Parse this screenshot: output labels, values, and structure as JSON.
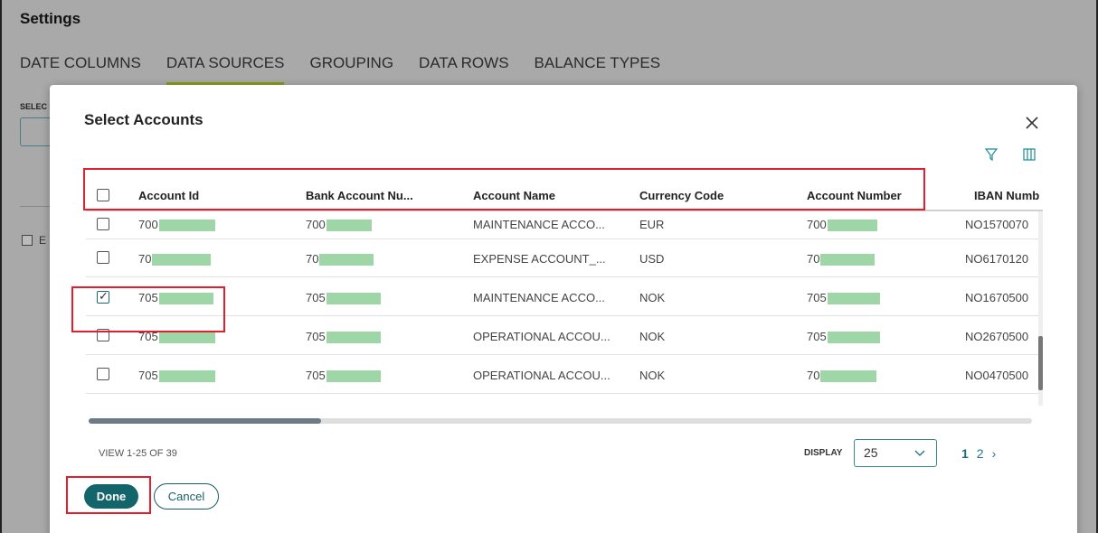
{
  "settings": {
    "title": "Settings",
    "tabs": [
      "DATE COLUMNS",
      "DATA SOURCES",
      "GROUPING",
      "DATA ROWS",
      "BALANCE TYPES"
    ],
    "active_tab": "DATA SOURCES",
    "bg_label": "SELEC",
    "bg_check_label": "E"
  },
  "modal": {
    "title": "Select Accounts",
    "columns": [
      "Account Id",
      "Bank Account Nu...",
      "Account Name",
      "Currency Code",
      "Account Number",
      "IBAN Numb"
    ],
    "rows": [
      {
        "checked": false,
        "account_id": "700",
        "bank_account": "700",
        "account_name": "MAINTENANCE ACCO...",
        "currency": "EUR",
        "account_number": "700",
        "iban": "NO1570070"
      },
      {
        "checked": false,
        "account_id": "70",
        "bank_account": "70",
        "account_name": "EXPENSE ACCOUNT_...",
        "currency": "USD",
        "account_number": "70",
        "iban": "NO6170120"
      },
      {
        "checked": true,
        "account_id": "705",
        "bank_account": "705",
        "account_name": "MAINTENANCE ACCO...",
        "currency": "NOK",
        "account_number": "705",
        "iban": "NO1670500"
      },
      {
        "checked": false,
        "account_id": "705",
        "bank_account": "705",
        "account_name": "OPERATIONAL ACCOU...",
        "currency": "NOK",
        "account_number": "705",
        "iban": "NO2670500"
      },
      {
        "checked": false,
        "account_id": "705",
        "bank_account": "705",
        "account_name": "OPERATIONAL ACCOU...",
        "currency": "NOK",
        "account_number": "70",
        "iban": "NO0470500"
      }
    ],
    "view_count": "VIEW 1-25 OF 39",
    "display_label": "DISPLAY",
    "display_value": "25",
    "pages": [
      "1",
      "2"
    ],
    "done_label": "Done",
    "cancel_label": "Cancel"
  },
  "colors": {
    "accent": "#13656b",
    "annotation": "#e0202f",
    "redaction": "#9fd6a7",
    "active_tab_underline": "#8a9a1c"
  }
}
